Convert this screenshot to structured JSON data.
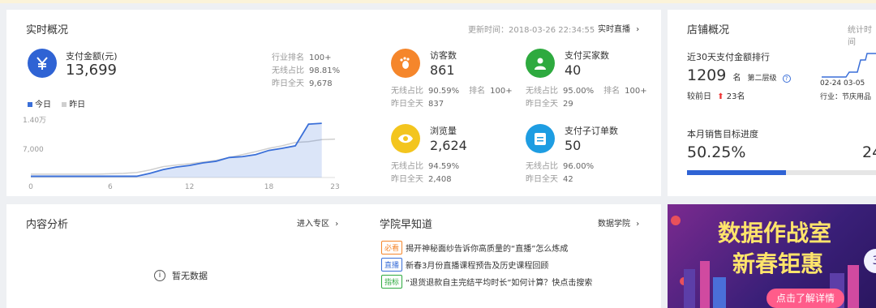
{
  "realtime": {
    "title": "实时概况",
    "update_label": "更新时间：2018-03-26 22:34:55",
    "live_link": "实时直播",
    "pay_amount": {
      "label": "支付金额(元)",
      "value": "13,699",
      "icon": "yen-icon",
      "stats": [
        {
          "label": "行业排名",
          "value": "100+"
        },
        {
          "label": "无线占比",
          "value": "98.81%"
        },
        {
          "label": "昨日全天",
          "value": "9,678"
        }
      ]
    },
    "legend": {
      "today": "今日",
      "yesterday": "昨日"
    },
    "kpis": [
      {
        "label": "访客数",
        "value": "861",
        "icon": "footprint-icon",
        "color": "#f5862b",
        "wireless_label": "无线占比",
        "wireless_value": "90.59%",
        "rank_label": "排名",
        "rank_value": "100+",
        "yesterday_label": "昨日全天",
        "yesterday_value": "837"
      },
      {
        "label": "支付买家数",
        "value": "40",
        "icon": "user-icon",
        "color": "#2eaa3f",
        "wireless_label": "无线占比",
        "wireless_value": "95.00%",
        "rank_label": "排名",
        "rank_value": "100+",
        "yesterday_label": "昨日全天",
        "yesterday_value": "29"
      },
      {
        "label": "浏览量",
        "value": "2,624",
        "icon": "eye-icon",
        "color": "#f3c51e",
        "wireless_label": "无线占比",
        "wireless_value": "94.59%",
        "yesterday_label": "昨日全天",
        "yesterday_value": "2,408"
      },
      {
        "label": "支付子订单数",
        "value": "50",
        "icon": "clipboard-icon",
        "color": "#1e9de2",
        "wireless_label": "无线占比",
        "wireless_value": "96.00%",
        "yesterday_label": "昨日全天",
        "yesterday_value": "42"
      }
    ]
  },
  "chart_data": {
    "type": "area",
    "x": [
      0,
      1,
      2,
      3,
      4,
      5,
      6,
      7,
      8,
      9,
      10,
      11,
      12,
      13,
      14,
      15,
      16,
      17,
      18,
      19,
      20,
      21,
      22,
      23
    ],
    "xticks": [
      "0",
      "6",
      "12",
      "18",
      "23"
    ],
    "yticks": [
      "1.40万",
      "7,000"
    ],
    "ylim": [
      0,
      14000
    ],
    "series": [
      {
        "name": "今日",
        "color": "#3a6fd8",
        "values": [
          300,
          300,
          300,
          300,
          300,
          300,
          300,
          300,
          300,
          1000,
          1900,
          2500,
          2900,
          3500,
          3900,
          4800,
          5000,
          5500,
          6500,
          7000,
          7600,
          12800,
          13000,
          null
        ]
      },
      {
        "name": "昨日",
        "color": "#cfcfcf",
        "values": [
          800,
          800,
          800,
          800,
          800,
          800,
          900,
          1000,
          1200,
          1800,
          2600,
          3000,
          3300,
          3700,
          4100,
          4800,
          5500,
          6200,
          7000,
          7600,
          8400,
          8600,
          9100,
          9200
        ]
      }
    ]
  },
  "store": {
    "title": "店铺概况",
    "corner_link": "统计时间",
    "rank_title": "近30天支付金额排行",
    "rank_value": "1209",
    "rank_unit": "名",
    "tier": "第二层级",
    "compare_label": "较前日",
    "compare_value": "23名",
    "dates": "02-24 03-05",
    "industry": "行业：节庆用品",
    "goal_title": "本月销售目标进度",
    "goal_percent": "50.25%",
    "goal_fraction": 0.5025,
    "goal_right": "24"
  },
  "content": {
    "title": "内容分析",
    "link": "进入专区",
    "empty": "暂无数据"
  },
  "academy": {
    "title": "学院早知道",
    "link": "数据学院",
    "items": [
      {
        "tag": "必看",
        "tag_color": "#f5862b",
        "text": "揭开神秘面纱告诉你高质量的“直播”怎么炼成"
      },
      {
        "tag": "直播",
        "tag_color": "#3a6fd8",
        "text": "新春3月份直播课程预告及历史课程回顾"
      },
      {
        "tag": "指标",
        "tag_color": "#2eaa3f",
        "text": "“退货退款自主完结平均时长”如何计算？快点击搜索"
      }
    ]
  },
  "banner": {
    "line1": "数据作战室",
    "line2": "新春钜惠",
    "button": "点击了解详情",
    "badge": "3"
  }
}
